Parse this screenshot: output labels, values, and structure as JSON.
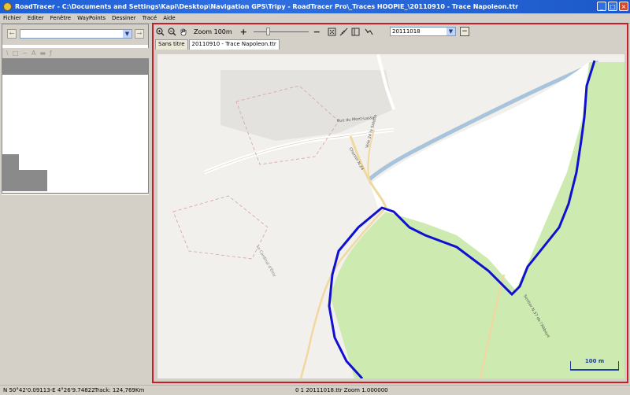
{
  "window": {
    "title": "RoadTracer - C:\\Documents and Settings\\Kapi\\Desktop\\Navigation GPS\\Tripy - RoadTracer Pro\\_Traces HOOPIE_\\20110910 - Trace Napoleon.ttr",
    "buttons": [
      "_",
      "□",
      "×"
    ]
  },
  "menu": [
    "Fichier",
    "Editer",
    "Fenêtre",
    "WayPoints",
    "Dessiner",
    "Tracé",
    "Aide"
  ],
  "left_panel": {
    "back_button": "←",
    "forward_button": "→",
    "combo_value": "",
    "draw_tools": [
      "\\",
      "□",
      "~",
      "A",
      "▬",
      "ƒ"
    ]
  },
  "map_toolbar": {
    "zoom_label": "Zoom 100m",
    "plus": "+",
    "minus": "−",
    "slider_value": 0.25,
    "date_select": "20111018",
    "remove_button": "−"
  },
  "tabs": [
    {
      "label": "Sans titre",
      "active": false
    },
    {
      "label": "20110910 - Trace Napoleon.ttr",
      "active": true
    }
  ],
  "map": {
    "streets": [
      {
        "label": "Rue du Mont-Lassy"
      },
      {
        "label": "Chemin N.24"
      },
      {
        "label": "Voie 24 la Salette"
      },
      {
        "label": "Le Cardinal d'Etoy"
      },
      {
        "label": "Sentier N.37 de l'Abbaye"
      }
    ],
    "scale_label": "100 m",
    "colors": {
      "track": "#1010d0",
      "forest": "#cdebb0",
      "water": "#a8c4dc",
      "land": "#f2f0ec",
      "white_area": "#ffffff"
    }
  },
  "status": {
    "coords": "N 50°42'0.09113-E   4°26'9.74822",
    "track": "Track: 124,769Km",
    "center": "0 1 20111018.ttr Zoom 1.000000"
  }
}
